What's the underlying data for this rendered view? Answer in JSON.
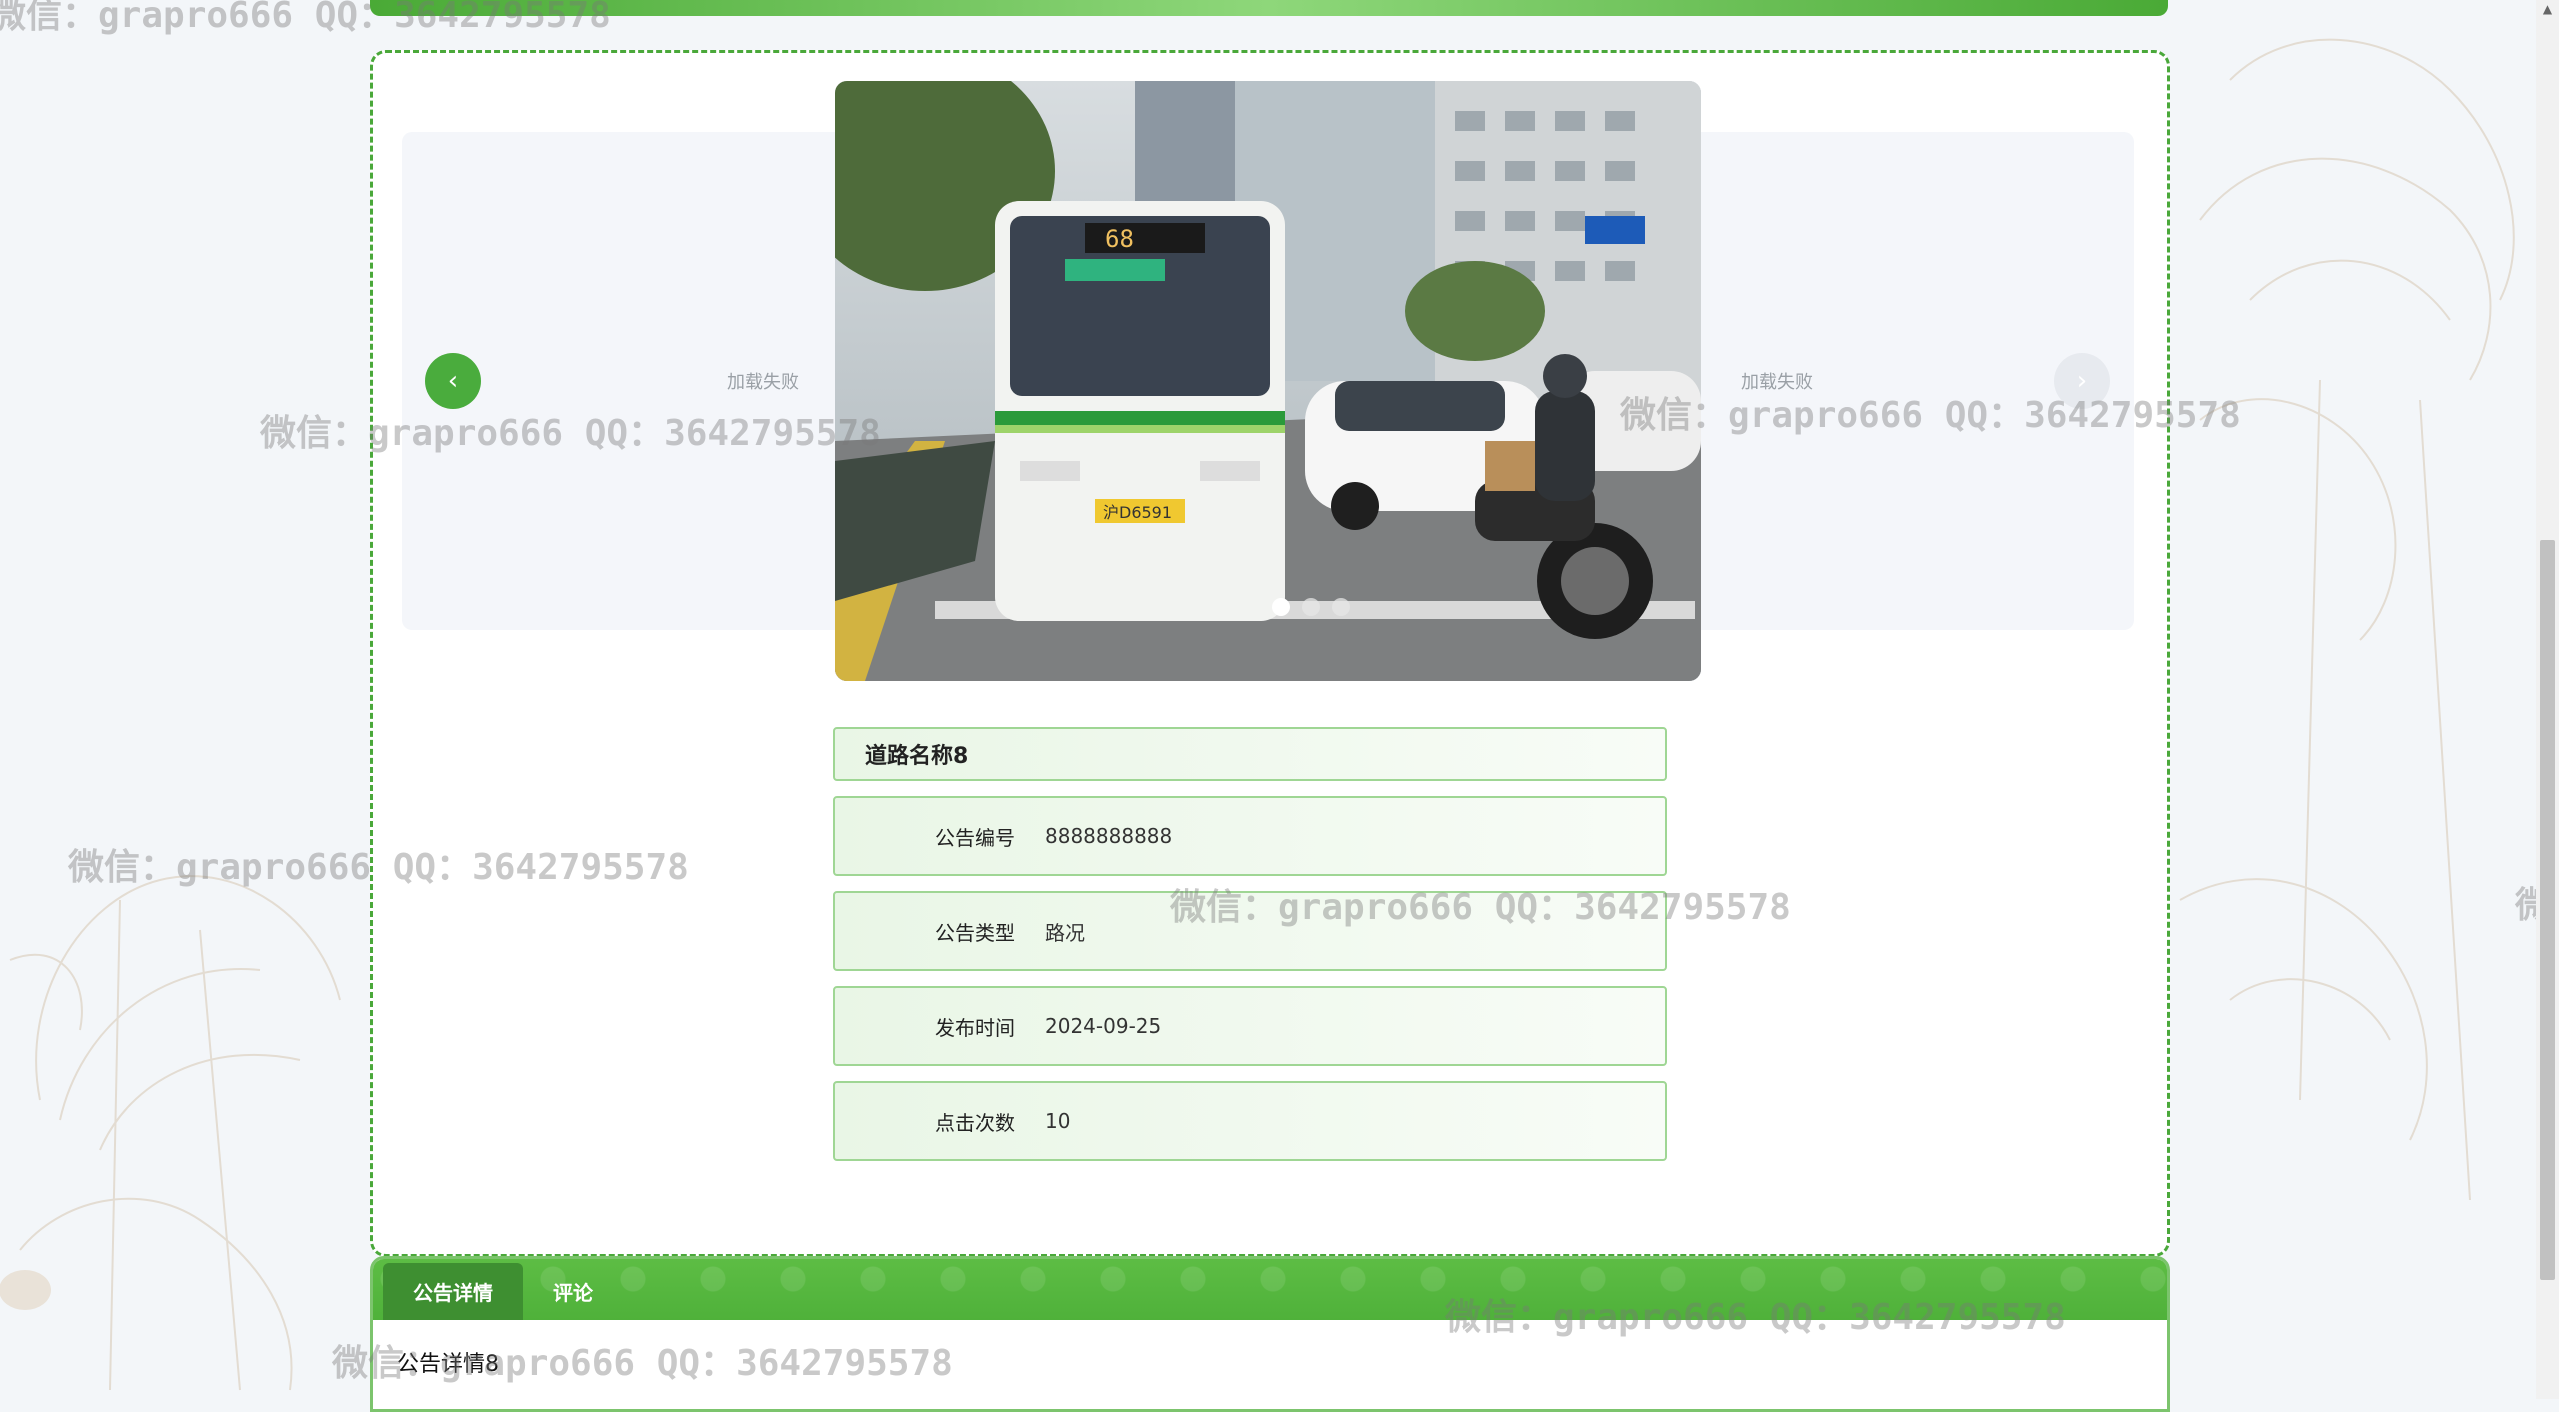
{
  "carousel": {
    "load_failed_left": "加载失败",
    "load_failed_right": "加载失败",
    "prev_icon": "‹",
    "next_icon": "›",
    "slide_count": 3,
    "active_slide": 1,
    "image": "photo-of-city-bus-on-street",
    "bus_route_sign": "68",
    "bus_plate": "沪D6591"
  },
  "info": {
    "title": "道路名称8",
    "rows": [
      {
        "label": "公告编号",
        "value": "8888888888"
      },
      {
        "label": "公告类型",
        "value": "路况"
      },
      {
        "label": "发布时间",
        "value": "2024-09-25"
      },
      {
        "label": "点击次数",
        "value": "10"
      }
    ]
  },
  "tabs": {
    "items": [
      {
        "label": "公告详情",
        "active": true
      },
      {
        "label": "评论",
        "active": false
      }
    ],
    "content": "公告详情8"
  },
  "watermark": "微信：grapro666 QQ：3642795578",
  "colors": {
    "accent": "#4aac3d",
    "border": "#9fd694",
    "dark_tab": "#3e8f31"
  }
}
